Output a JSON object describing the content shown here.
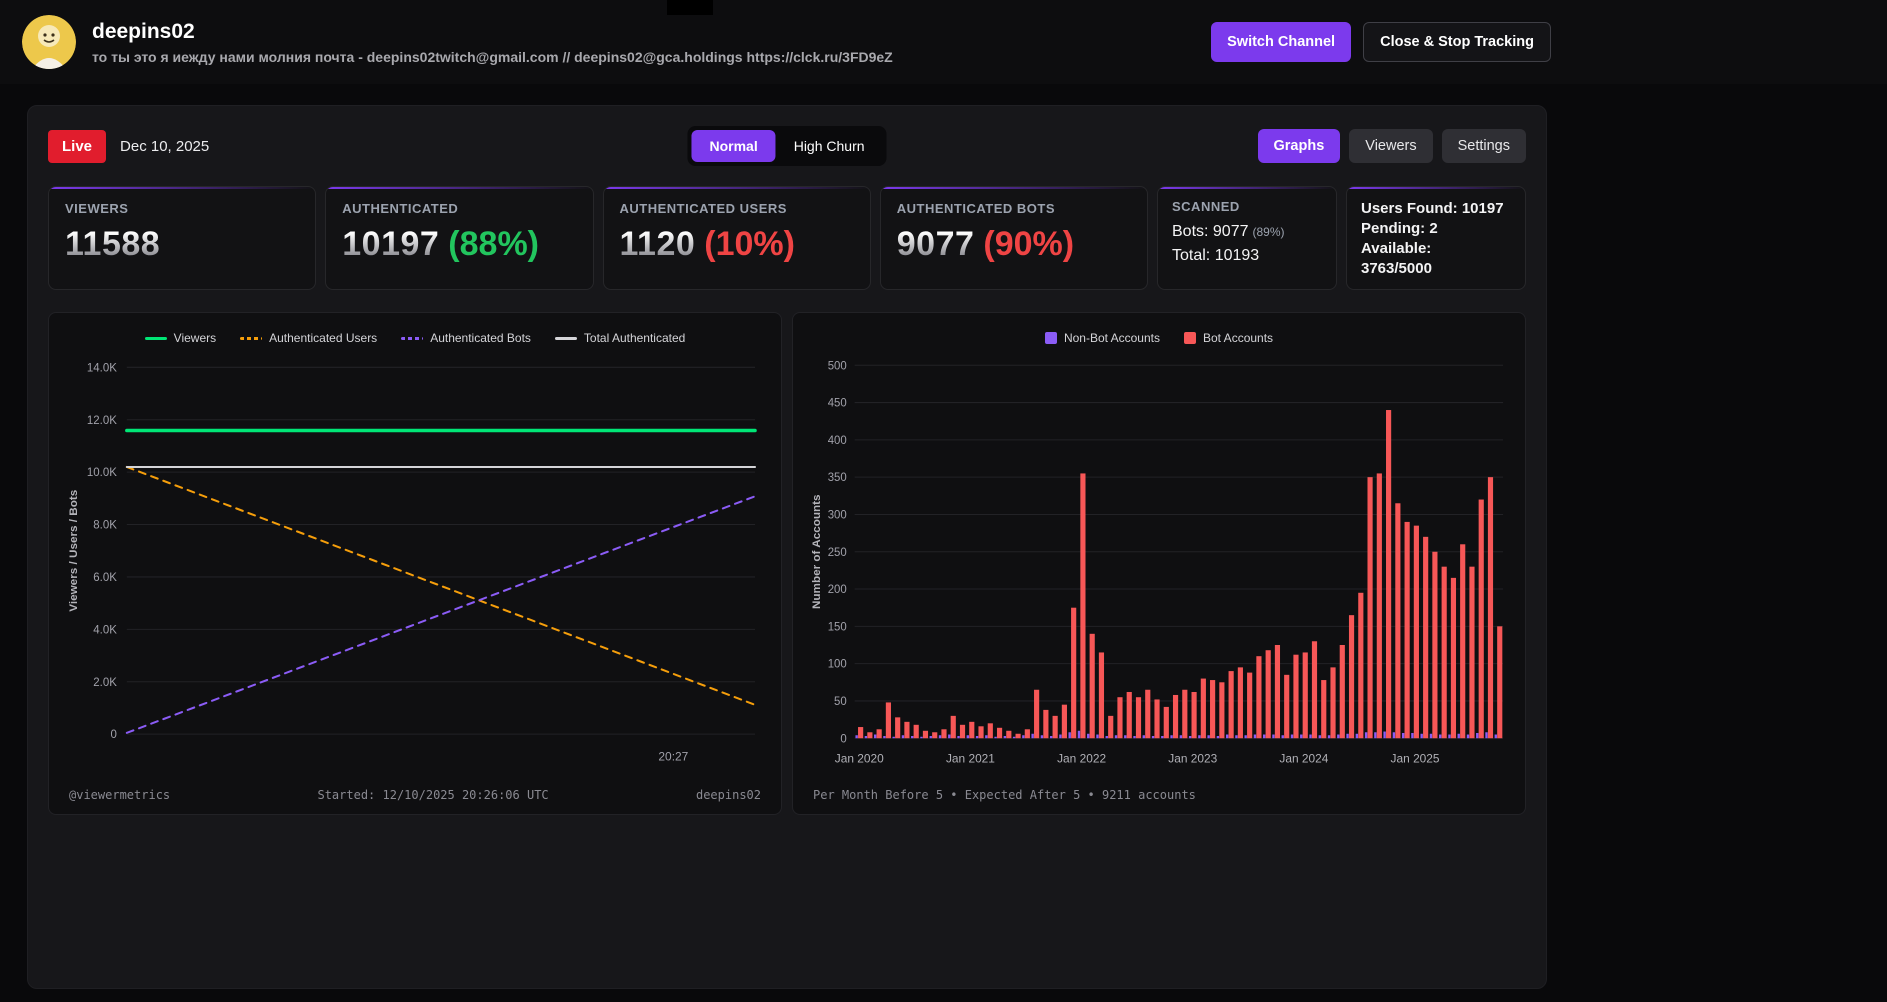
{
  "colors": {
    "accent_purple": "#7c3aed",
    "live_red": "#e11d2d",
    "percent_green": "#22c55e",
    "percent_red": "#ef4444",
    "bar_red": "#f75757",
    "bar_purple": "#8b5cf6"
  },
  "header": {
    "channel_name": "deepins02",
    "subtitle": "то ты это я иежду нами молния почта - deepins02twitch@gmail.com // deepins02@gca.holdings https://clck.ru/3FD9eZ",
    "buttons": {
      "switch_channel": "Switch Channel",
      "close_stop": "Close & Stop Tracking"
    }
  },
  "toolbar": {
    "live_label": "Live",
    "date": "Dec 10, 2025",
    "mode": {
      "normal": "Normal",
      "high_churn": "High Churn",
      "active": "Normal"
    },
    "views": {
      "graphs": "Graphs",
      "viewers": "Viewers",
      "settings": "Settings",
      "active": "Graphs"
    }
  },
  "stats": {
    "viewers": {
      "label": "VIEWERS",
      "value": "11588"
    },
    "authenticated": {
      "label": "AUTHENTICATED",
      "value": "10197",
      "percent": "(88%)",
      "percent_color": "#22c55e"
    },
    "authenticated_users": {
      "label": "AUTHENTICATED USERS",
      "value": "1120",
      "percent": "(10%)",
      "percent_color": "#ef4444"
    },
    "authenticated_bots": {
      "label": "AUTHENTICATED BOTS",
      "value": "9077",
      "percent": "(90%)",
      "percent_color": "#ef4444"
    },
    "scanned": {
      "label": "SCANNED",
      "bots_line": "Bots: 9077",
      "bots_percent": "(89%)",
      "total_line": "Total: 10193"
    },
    "summary": {
      "line1": "Users Found: 10197",
      "line2": "Pending: 2",
      "line3": "Available:",
      "line4": "3763/5000"
    }
  },
  "chart_data": [
    {
      "type": "line",
      "title": "",
      "ylabel": "Viewers / Users / Bots",
      "ylim": [
        0,
        14000
      ],
      "y_ticks": [
        "0",
        "2.0K",
        "4.0K",
        "6.0K",
        "8.0K",
        "10.0K",
        "12.0K",
        "14.0K"
      ],
      "x_tick": {
        "label": "20:27",
        "pos": 0.87
      },
      "grid": true,
      "legend_position": "top",
      "series": [
        {
          "name": "Viewers",
          "color": "#00e676",
          "dash": false,
          "width": 3.5,
          "points": [
            [
              0,
              11588
            ],
            [
              1,
              11588
            ]
          ]
        },
        {
          "name": "Authenticated Users",
          "color": "#f59e0b",
          "dash": true,
          "width": 2,
          "points": [
            [
              0,
              10197
            ],
            [
              1,
              1120
            ]
          ]
        },
        {
          "name": "Authenticated Bots",
          "color": "#8b5cf6",
          "dash": true,
          "width": 2,
          "points": [
            [
              0,
              50
            ],
            [
              1,
              9077
            ]
          ]
        },
        {
          "name": "Total Authenticated",
          "color": "#d4d4d8",
          "dash": false,
          "width": 2,
          "points": [
            [
              0,
              10197
            ],
            [
              1,
              10197
            ]
          ]
        }
      ],
      "footer": {
        "left": "@viewermetrics",
        "center": "Started: 12/10/2025 20:26:06 UTC",
        "right": "deepins02"
      }
    },
    {
      "type": "bar",
      "title": "",
      "ylabel": "Number of Accounts",
      "ylim": [
        0,
        500
      ],
      "y_tick_step": 50,
      "grid": true,
      "legend_position": "top",
      "x_tick_labels": [
        "Jan 2020",
        "Jan 2021",
        "Jan 2022",
        "Jan 2023",
        "Jan 2024",
        "Jan 2025"
      ],
      "x_tick_positions": [
        0,
        12,
        24,
        36,
        48,
        60
      ],
      "x_start": "Jan 2020",
      "x_months": 70,
      "series": [
        {
          "name": "Non-Bot Accounts",
          "color": "#8b5cf6",
          "values": [
            4,
            3,
            5,
            3,
            2,
            4,
            3,
            2,
            3,
            4,
            5,
            3,
            4,
            3,
            4,
            2,
            3,
            2,
            4,
            6,
            4,
            3,
            5,
            8,
            10,
            6,
            5,
            3,
            4,
            4,
            3,
            4,
            3,
            3,
            4,
            4,
            3,
            4,
            4,
            3,
            5,
            4,
            4,
            5,
            5,
            5,
            4,
            5,
            5,
            5,
            4,
            4,
            5,
            6,
            6,
            8,
            8,
            9,
            8,
            7,
            7,
            6,
            6,
            5,
            5,
            6,
            5,
            7,
            8,
            5
          ]
        },
        {
          "name": "Bot Accounts",
          "color": "#f75757",
          "values": [
            15,
            8,
            12,
            48,
            28,
            22,
            18,
            10,
            8,
            12,
            30,
            18,
            22,
            16,
            20,
            14,
            10,
            6,
            12,
            65,
            38,
            30,
            45,
            175,
            355,
            140,
            115,
            30,
            55,
            62,
            55,
            65,
            52,
            42,
            58,
            65,
            62,
            80,
            78,
            75,
            90,
            95,
            88,
            110,
            118,
            125,
            85,
            112,
            115,
            130,
            78,
            95,
            125,
            165,
            195,
            350,
            355,
            440,
            315,
            290,
            285,
            270,
            250,
            230,
            215,
            260,
            230,
            320,
            350,
            150
          ]
        }
      ],
      "footer": {
        "left": "Per Month Before 5 • Expected After 5 • 9211 accounts"
      }
    }
  ]
}
